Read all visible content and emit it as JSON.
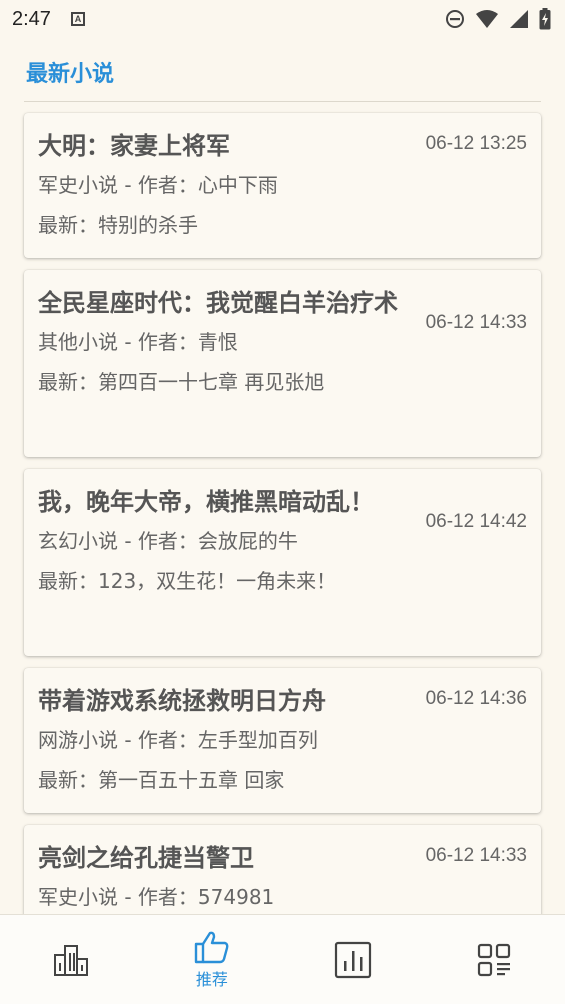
{
  "status": {
    "time": "2:47",
    "a_glyph": "A"
  },
  "section": {
    "title": "最新小说"
  },
  "novels": [
    {
      "title": "大明：家妻上将军",
      "time": "06-12 13:25",
      "sub": "军史小说 - 作者：心中下雨",
      "latest": "最新：特别的杀手"
    },
    {
      "title": "全民星座时代：我觉醒白羊治疗术",
      "time": "06-12 14:33",
      "sub": "其他小说 - 作者：青恨",
      "latest": "最新：第四百一十七章 再见张旭"
    },
    {
      "title": "我，晚年大帝，横推黑暗动乱！",
      "time": "06-12 14:42",
      "sub": "玄幻小说 - 作者：会放屁的牛",
      "latest": "最新：123，双生花！一角未来！"
    },
    {
      "title": "带着游戏系统拯救明日方舟",
      "time": "06-12 14:36",
      "sub": "网游小说 - 作者：左手型加百列",
      "latest": "最新：第一百五十五章 回家"
    },
    {
      "title": "亮剑之给孔捷当警卫",
      "time": "06-12 14:33",
      "sub": "军史小说 - 作者：574981",
      "latest": ""
    }
  ],
  "nav": {
    "items": [
      {
        "icon": "ranking-icon",
        "label": ""
      },
      {
        "icon": "thumbs-up-icon",
        "label": "推荐"
      },
      {
        "icon": "chart-icon",
        "label": ""
      },
      {
        "icon": "category-icon",
        "label": ""
      }
    ],
    "active_color": "#2a8fd8",
    "inactive_color": "#444444"
  }
}
